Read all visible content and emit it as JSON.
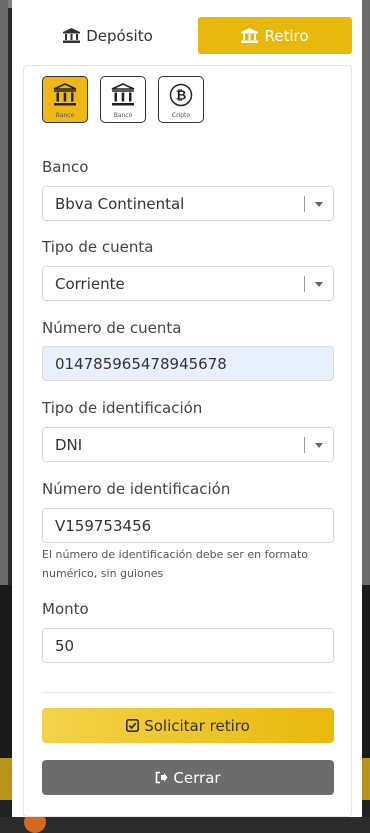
{
  "tabs": {
    "deposit_label": "Depósito",
    "withdraw_label": "Retiro"
  },
  "methods": [
    {
      "label": "Banco",
      "icon": "bank-icon",
      "active": true
    },
    {
      "label": "Banco",
      "icon": "bank-icon",
      "active": false
    },
    {
      "label": "Cripto",
      "icon": "bitcoin-icon",
      "active": false
    }
  ],
  "form": {
    "bank_label": "Banco",
    "bank_value": "Bbva Continental",
    "account_type_label": "Tipo de cuenta",
    "account_type_value": "Corriente",
    "account_number_label": "Número de cuenta",
    "account_number_value": "014785965478945678",
    "id_type_label": "Tipo de identificación",
    "id_type_value": "DNI",
    "id_number_label": "Número de identificación",
    "id_number_value": "V159753456",
    "id_help": "El número de identificación debe ser en formato numérico, sin guiones",
    "amount_label": "Monto",
    "amount_value": "50"
  },
  "actions": {
    "submit_label": "Solicitar retiro",
    "close_label": "Cerrar"
  },
  "colors": {
    "accent": "#e8b90c",
    "close_button": "#6c6c6c",
    "filled_input": "#e8f0fe"
  }
}
